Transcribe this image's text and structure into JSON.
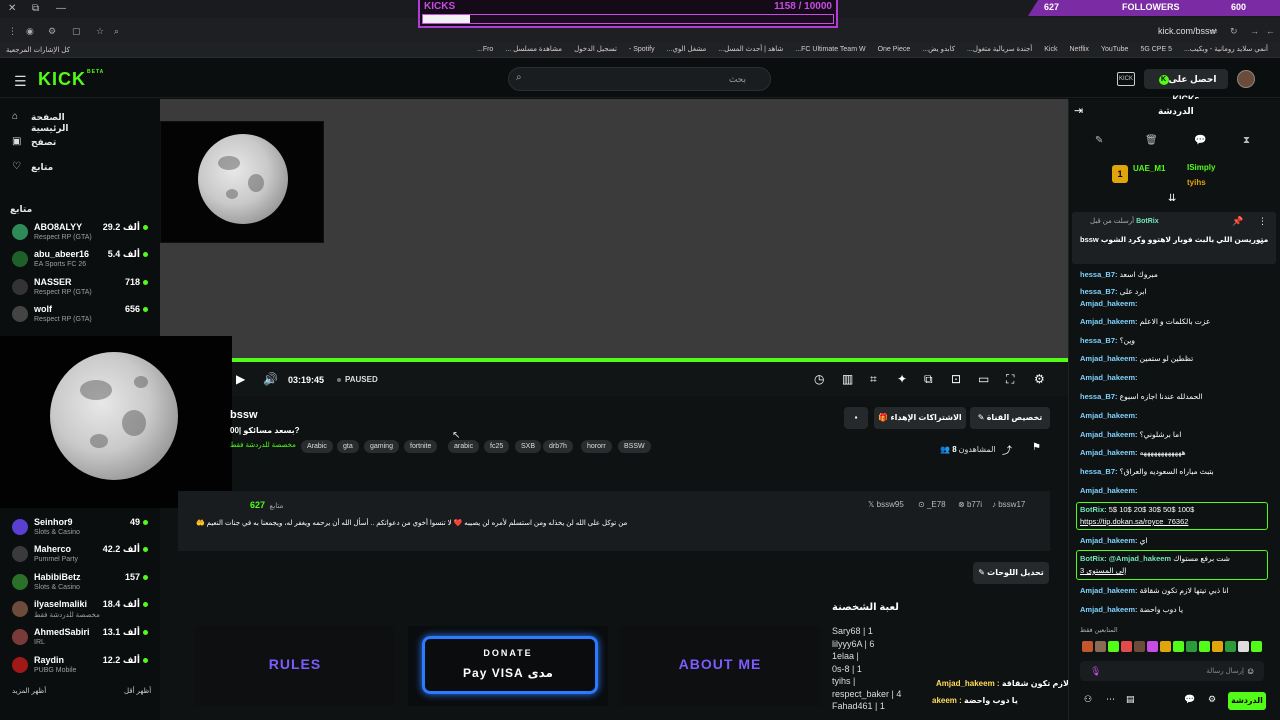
{
  "browser": {
    "url": "kick.com/bssw",
    "bookmarks": [
      "أنمي سلايد رومانية - وبكيب...",
      "5G CPE 5",
      "YouTube",
      "Netflix",
      "Kick",
      "أجندة سريالية متغول...",
      "كابدو يض...",
      "One Piece",
      "FC Ultimate Team W...",
      "شاهد | أحدث المسل...",
      "مشغل الوي...",
      "Spotify -",
      "تسجيل الدخول",
      "مشاهدة مسلسل ...",
      "Fro..."
    ],
    "bookmarks_left": "كل الإشارات المرجعية"
  },
  "overlay": {
    "kicks_label": "KICKS",
    "kicks_count": "1158  / 10000",
    "kicks_progress": 0.115,
    "followers_left": "627",
    "followers_label": "FOLLOWERS",
    "followers_right": "600",
    "overlay_msg1_user": "Amjad_hakeem :",
    "overlay_msg1_text": "انا ذبي تيتها لازم تكون شقاقة",
    "overlay_msg2_user": "akeem :",
    "overlay_msg2_text": "يا دوب واحضة"
  },
  "header": {
    "logo": "KICK",
    "logo_beta": "BETA",
    "search_placeholder": "بحث",
    "get_kicks": "احصل على KICKs",
    "get_kicks_icon": "K"
  },
  "sidebar": {
    "nav": [
      {
        "label": "الصفحة الرئيسية",
        "icon": "home-icon",
        "glyph": "⌂"
      },
      {
        "label": "تصفح",
        "icon": "browse-icon",
        "glyph": "▣"
      },
      {
        "label": "متابع",
        "icon": "heart-icon",
        "glyph": "♡"
      }
    ],
    "following_header": "متابع",
    "channels": [
      {
        "name": "ABO8ALYY",
        "category": "Respect RP (GTA)",
        "viewers": "29.2 ألف",
        "color": "#2e8b57"
      },
      {
        "name": "abu_abeer16",
        "category": "EA Sports FC 26",
        "viewers": "5.4 ألف",
        "color": "#1f5f2a"
      },
      {
        "name": "NASSER",
        "category": "Respect RP (GTA)",
        "viewers": "718",
        "color": "#333333"
      },
      {
        "name": "wolf",
        "category": "Respect RP (GTA)",
        "viewers": "656",
        "color": "#444444"
      },
      {
        "name": "Seinhor9",
        "category": "Slots & Casino",
        "viewers": "49",
        "color": "#5b3fd1"
      },
      {
        "name": "Maherco",
        "category": "Pummel Party",
        "viewers": "42.2 ألف",
        "color": "#3a3a3a"
      },
      {
        "name": "HabibiBetz",
        "category": "Slots & Casino",
        "viewers": "157",
        "color": "#2a6f2a"
      },
      {
        "name": "ilyaselmaliki",
        "category": "مخصصة للدردشة فقط",
        "viewers": "18.4 ألف",
        "color": "#6b4b3a"
      },
      {
        "name": "AhmedSabiri",
        "category": "IRL",
        "viewers": "13.1 ألف",
        "color": "#7a3a3a"
      },
      {
        "name": "Raydin",
        "category": "PUBG Mobile",
        "viewers": "12.2 ألف",
        "color": "#a01818"
      }
    ],
    "show_more": "أظهر المزيد",
    "show_less": "أظهر أقل"
  },
  "player": {
    "time": "03:19:45",
    "status": "PAUSED",
    "progress": 1.0
  },
  "stream": {
    "streamer": "bssw",
    "subtitle": "بسعد مسائكو |00?",
    "language": "مخصصة للدردشة فقط",
    "tags": [
      "Arabic",
      "gta",
      "gaming",
      "fortnite",
      "arabic",
      "fc25",
      "SXB",
      "drb7h",
      "hororr",
      "BSSW"
    ],
    "viewers_label": "المشاهدون",
    "viewers_count": "8",
    "customize_button": "تخصيص القناة",
    "subs_button": "الاشتراكات الإهداء",
    "followers_count": "627",
    "followers_label": "متابع",
    "socials": [
      "bssw95",
      "_E78",
      "b77i",
      "bssw17"
    ],
    "bio": "من توكل على الله لن يخذله ومن استسلم لأمره لن يصيبه ❤️ لا تنسوا أخوي من دعواتكم .. أسأل الله أن يرحمه ويغفر له، ويجمعنا به في جنات النعيم 🤲",
    "edit_panels": "تحديل اللوحات"
  },
  "panels": [
    {
      "title": "RULES",
      "color": "#8a6bff"
    },
    {
      "title": "DONATE",
      "subtitle": "Pay  VISA  مدى",
      "color": "#ffffff"
    },
    {
      "title": "ABOUT ME",
      "color": "#8a6bff"
    }
  ],
  "leaderboard": {
    "title": "لعبة الشخصنة",
    "entries": [
      "Sary68 | 1",
      "lilyyy6A | 6",
      "1elaa |",
      "0s-8 | 1",
      "tyihs |",
      "respect_baker | 4",
      "Fahad461 | 1"
    ]
  },
  "chat": {
    "title": "الدردشة",
    "top_users": [
      {
        "rank": "1",
        "name": "UAE_M1"
      },
      {
        "rank": "",
        "name": "ISimply"
      },
      {
        "rank": "",
        "name": "tyihs"
      }
    ],
    "pinned_by": "أرسلت من قبل",
    "pinned_user": "BotRix",
    "pinned_text": "bssw متوريسن اللي بالبث فوبار لاهتوو وكرد الشوب",
    "messages": [
      {
        "user": "hessa_B7:",
        "text": "مبروك اسعد",
        "green": false
      },
      {
        "user": "hessa_B7:",
        "text": "ابرد على",
        "green": false
      },
      {
        "user": "Amjad_hakeem:",
        "text": "",
        "green": false
      },
      {
        "user": "Amjad_hakeem:",
        "text": "عزت بالكلمات و الاعلم",
        "green": false
      },
      {
        "user": "hessa_B7:",
        "text": "وين؟",
        "green": false
      },
      {
        "user": "Amjad_hakeem:",
        "text": "تظطين لو ستمين",
        "green": false
      },
      {
        "user": "Amjad_hakeem:",
        "text": "",
        "green": false
      },
      {
        "user": "hessa_B7:",
        "text": "الحمدلله عندنا اجازه اسبوع",
        "green": false
      },
      {
        "user": "Amjad_hakeem:",
        "text": "",
        "green": false
      },
      {
        "user": "Amjad_hakeem:",
        "text": "اما برشلوني؟",
        "green": false
      },
      {
        "user": "Amjad_hakeem:",
        "text": "ههههههههههههه",
        "green": false
      },
      {
        "user": "hessa_B7:",
        "text": "بتبث مباراه السعوديه والعراق؟",
        "green": false
      },
      {
        "user": "Amjad_hakeem:",
        "text": "",
        "green": false
      },
      {
        "user": "BotRix:",
        "text": "5$ 10$ 20$ 30$ 50$ 100$",
        "green": true
      },
      {
        "user": "",
        "text": "https://tip.dokan.sa/royce_76362",
        "green": true
      },
      {
        "user": "Amjad_hakeem:",
        "text": "اي",
        "green": false
      },
      {
        "user": "BotRix: @Amjad_hakeem",
        "text": "شت برفع مستواك",
        "green": true
      },
      {
        "user": "",
        "text": "إلى المستوى 3",
        "green": true
      },
      {
        "user": "Amjad_hakeem:",
        "text": "انا ذبي تيتها لازم تكون شقاقة",
        "green": false
      },
      {
        "user": "Amjad_hakeem:",
        "text": "يا دوب واحضة",
        "green": false
      }
    ],
    "emote_label": "المتابعين فقط",
    "input_placeholder": "إرسال رسالة",
    "send_button": "الدردشة"
  }
}
